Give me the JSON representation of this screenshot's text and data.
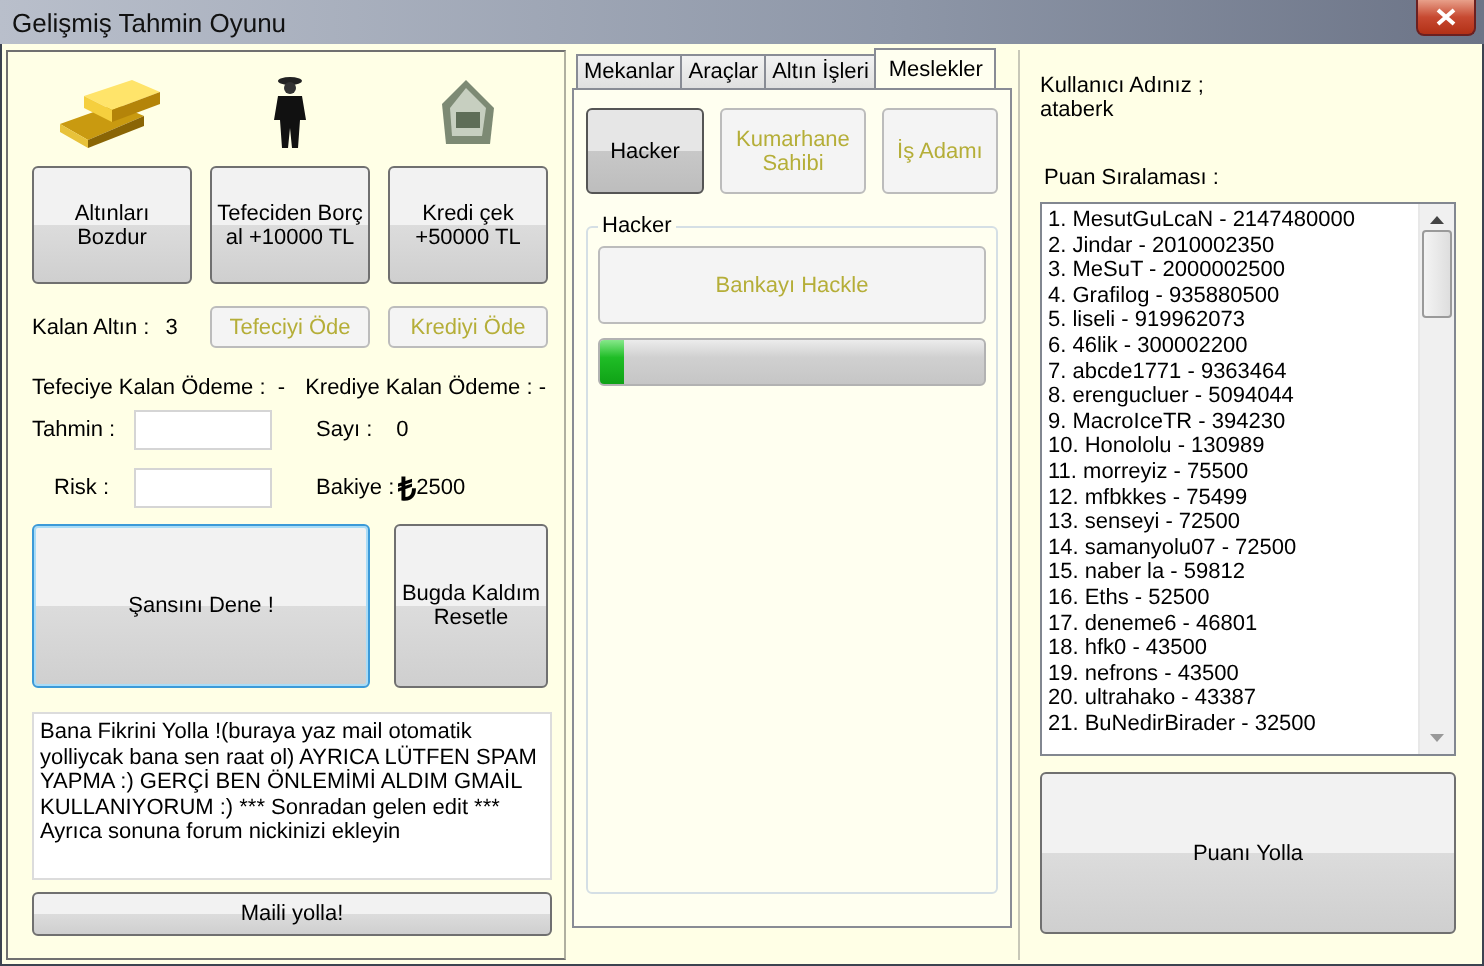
{
  "window": {
    "title": "Gelişmiş Tahmin Oyunu"
  },
  "left": {
    "actions": [
      {
        "label": "Altınları Bozdur"
      },
      {
        "label": "Tefeciden Borç al +10000 TL"
      },
      {
        "label": "Kredi çek +50000 TL"
      }
    ],
    "gold_label": "Kalan Altın :",
    "gold_value": "3",
    "pay_buttons": [
      {
        "label": "Tefeciyi Öde",
        "disabled": true
      },
      {
        "label": "Krediyi Öde",
        "disabled": true
      }
    ],
    "loan_shark_due": "Tefeciye Kalan Ödeme :  -",
    "credit_due": "Krediye Kalan Ödeme : -",
    "guess_label": "Tahmin :",
    "risk_label": "Risk :",
    "count_label": "Sayı :",
    "count_value": "0",
    "balance_label": "Bakiye :",
    "balance_currency": "₺",
    "balance_value": "2500",
    "try_button": {
      "label": "Şansını Dene !",
      "focused": true
    },
    "reset_button": {
      "label": "Bugda Kaldım Resetle"
    },
    "feedback_text": "Bana Fikrini Yolla !(buraya yaz mail otomatik yolliycak bana sen raat ol) AYRICA LÜTFEN SPAM YAPMA :) GERÇİ BEN ÖNLEMİMİ ALDIM GMAİL KULLANIYORUM :) *** Sonradan gelen edit *** Ayrıca sonuna forum nickinizi ekleyin",
    "mail_button": "Maili yolla!"
  },
  "tabs": [
    {
      "label": "Mekanlar",
      "selected": false
    },
    {
      "label": "Araçlar",
      "selected": false
    },
    {
      "label": "Altın İşleri",
      "selected": false
    },
    {
      "label": "Meslekler",
      "selected": true
    }
  ],
  "professions": [
    {
      "label": "Hacker",
      "selected": true,
      "disabled": false
    },
    {
      "label": "Kumarhane Sahibi",
      "selected": false,
      "disabled": true
    },
    {
      "label": "İş Adamı",
      "selected": false,
      "disabled": true
    }
  ],
  "hacker_group": {
    "title": "Hacker",
    "button": {
      "label": "Bankayı Hackle",
      "disabled": true
    },
    "progress": {
      "level": 0.06
    }
  },
  "right": {
    "user_label": "Kullanıcı Adınız ;",
    "user_name": "ataberk",
    "ranking_label": "Puan Sıralaması :",
    "ranking": [
      "1. MesutGuLcaN - 2147480000",
      "2. Jindar - 2010002350",
      "3. MeSuT - 2000002500",
      "4. Grafilog - 935880500",
      "5. liseli - 919962073",
      "6. 46lik - 300002200",
      "7. abcde1771 - 9363464",
      "8. erengucluer - 5094044",
      "9. MacroIceTR - 394230",
      "10. Honololu - 130989",
      "11. morreyiz - 75500",
      "12. mfbkkes - 75499",
      "13. senseyi - 72500",
      "14. samanyolu07 - 72500",
      "15. naber la - 59812",
      "16. Eths - 52500",
      "17. deneme6 - 46801",
      "18. hfk0 - 43500",
      "19. nefrons - 43500",
      "20. ultrahako - 43387",
      "21. BuNedirBirader - 32500"
    ],
    "send_button": "Puanı Yolla"
  }
}
